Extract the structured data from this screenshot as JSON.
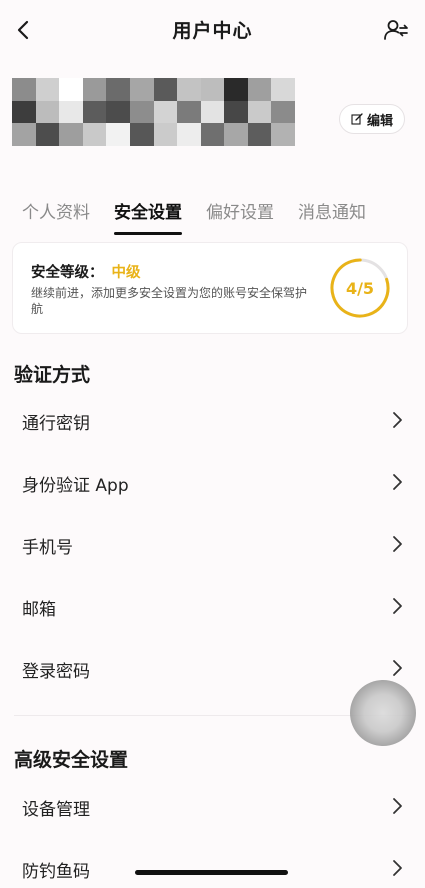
{
  "header": {
    "title": "用户中心",
    "back_icon": "chevron-left-icon",
    "right_icon": "user-switch-icon"
  },
  "profile": {
    "edit_label": "编辑",
    "edit_icon": "edit-icon"
  },
  "tabs": [
    {
      "label": "个人资料",
      "active": false
    },
    {
      "label": "安全设置",
      "active": true
    },
    {
      "label": "偏好设置",
      "active": false
    },
    {
      "label": "消息通知",
      "active": false
    }
  ],
  "security": {
    "level_label": "安全等级：",
    "level_value": "中级",
    "description": "继续前进，添加更多安全设置为您的账号安全保驾护航",
    "progress_text": "4/5",
    "progress_fraction": 0.8,
    "accent_color": "#e9b318"
  },
  "verification": {
    "title": "验证方式",
    "items": [
      {
        "label": "通行密钥"
      },
      {
        "label": "身份验证 App"
      },
      {
        "label": "手机号"
      },
      {
        "label": "邮箱"
      },
      {
        "label": "登录密码"
      }
    ]
  },
  "advanced": {
    "title": "高级安全设置",
    "items": [
      {
        "label": "设备管理"
      },
      {
        "label": "防钓鱼码"
      }
    ]
  }
}
